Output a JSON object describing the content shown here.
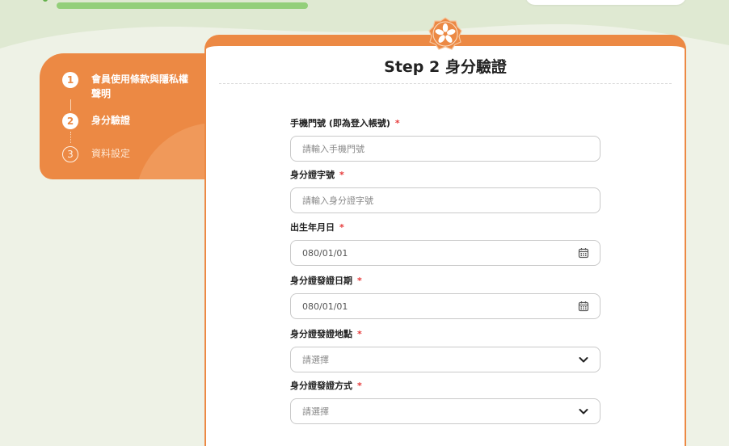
{
  "colors": {
    "accent": "#ec8944",
    "required": "#e63a3a",
    "background": "#eef2e6",
    "progress": "#93cf7a"
  },
  "steps": [
    {
      "number": "1",
      "label": "會員使用條款與隱私權聲明",
      "state": "done"
    },
    {
      "number": "2",
      "label": "身分驗證",
      "state": "current"
    },
    {
      "number": "3",
      "label": "資料設定",
      "state": "pending"
    }
  ],
  "form": {
    "title": "Step 2 身分驗證",
    "required_mark": "*",
    "fields": [
      {
        "label": "手機門號 (即為登入帳號)",
        "placeholder": "請輸入手機門號",
        "value": "",
        "icon": ""
      },
      {
        "label": "身分證字號",
        "placeholder": "請輸入身分證字號",
        "value": "",
        "icon": ""
      },
      {
        "label": "出生年月日",
        "placeholder": "",
        "value": "080/01/01",
        "icon": "calendar-icon"
      },
      {
        "label": "身分證發證日期",
        "placeholder": "",
        "value": "080/01/01",
        "icon": "calendar-icon"
      },
      {
        "label": "身分證發證地點",
        "placeholder": "請選擇",
        "value": "",
        "icon": "chevron-down-icon"
      },
      {
        "label": "身分證發證方式",
        "placeholder": "請選擇",
        "value": "",
        "icon": "chevron-down-icon"
      }
    ]
  }
}
